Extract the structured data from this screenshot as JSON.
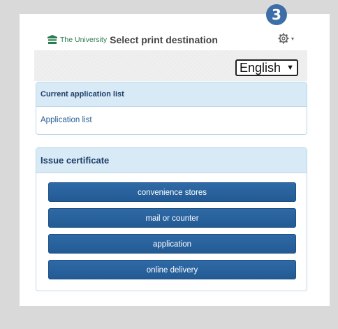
{
  "step_badge": "3",
  "header": {
    "logo_text": "The University",
    "title": "Select print destination",
    "settings_icon": "gear-icon"
  },
  "language": {
    "selected": "English"
  },
  "current_application": {
    "heading": "Current application list",
    "link": "Application list"
  },
  "issue_certificate": {
    "heading": "Issue certificate",
    "buttons": [
      "convenience stores",
      "mail or counter",
      "application",
      "online delivery"
    ]
  },
  "colors": {
    "badge": "#3e6ea8",
    "button": "#2b629d",
    "card_head": "#d8eaf6",
    "logo": "#2d7a52"
  }
}
